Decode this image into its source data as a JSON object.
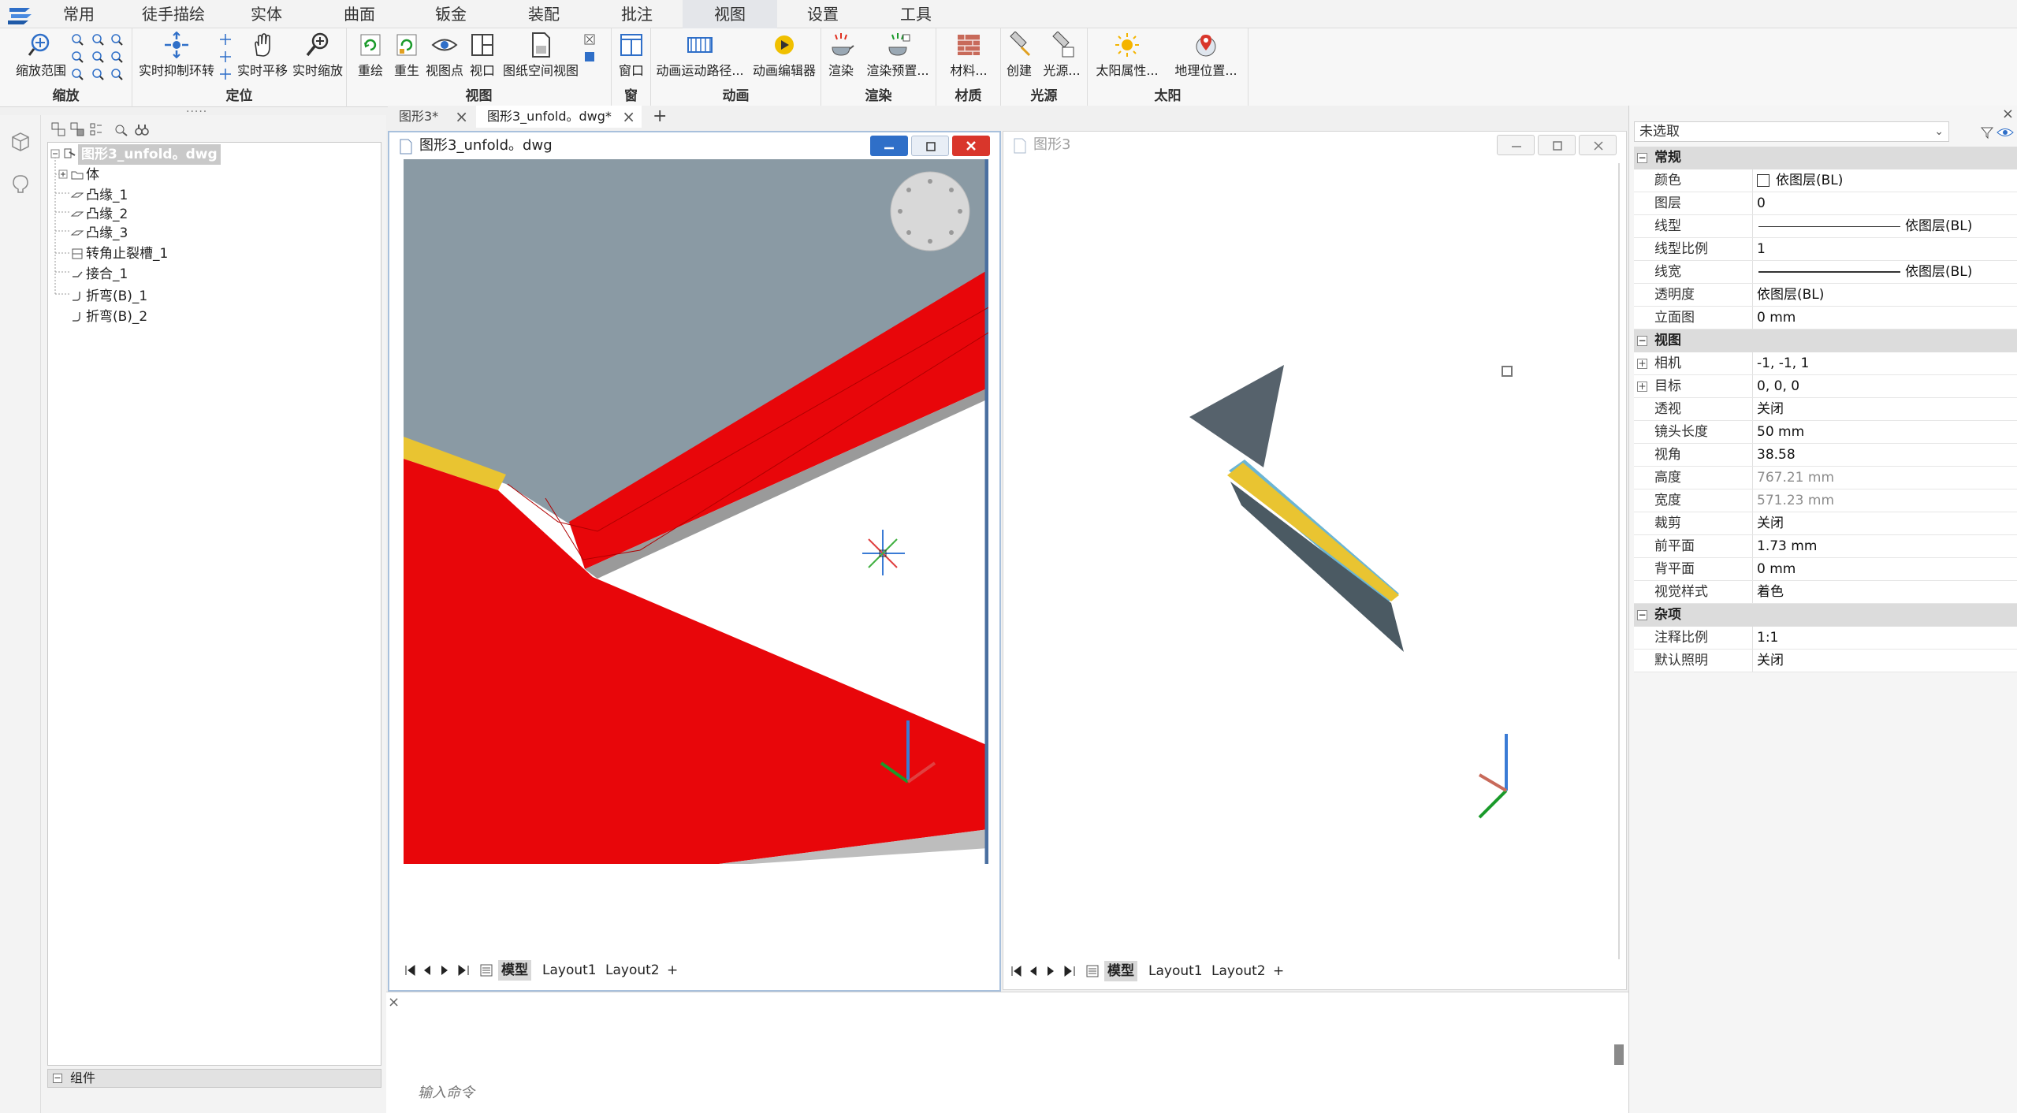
{
  "ribbon": {
    "tabs": [
      {
        "label": "常用"
      },
      {
        "label": "徒手描绘"
      },
      {
        "label": "实体"
      },
      {
        "label": "曲面"
      },
      {
        "label": "钣金"
      },
      {
        "label": "装配"
      },
      {
        "label": "批注"
      },
      {
        "label": "视图"
      },
      {
        "label": "设置"
      },
      {
        "label": "工具"
      }
    ],
    "active_tab": "视图",
    "groups": {
      "zoom": {
        "label": "缩放",
        "buttons": [
          "缩放范围"
        ]
      },
      "position": {
        "label": "定位",
        "buttons": [
          "实时抑制环转",
          "实时平移",
          "实时缩放"
        ]
      },
      "view": {
        "label": "视图",
        "buttons": [
          "重绘",
          "重生",
          "视图点",
          "视口",
          "图纸空间视图"
        ]
      },
      "window": {
        "label": "窗",
        "buttons": [
          "窗口"
        ]
      },
      "animation": {
        "label": "动画",
        "buttons": [
          "动画运动路径...",
          "动画编辑器"
        ]
      },
      "render": {
        "label": "渲染",
        "buttons": [
          "渲染",
          "渲染预置..."
        ]
      },
      "material": {
        "label": "材质",
        "buttons": [
          "材料..."
        ]
      },
      "light": {
        "label": "光源",
        "buttons": [
          "创建",
          "光源..."
        ]
      },
      "sun": {
        "label": "太阳",
        "buttons": [
          "太阳属性...",
          "地理位置..."
        ]
      }
    }
  },
  "browser": {
    "tree": {
      "root": "图形3_unfold。dwg",
      "items": [
        "体",
        "凸缘_1",
        "凸缘_2",
        "凸缘_3",
        "转角止裂槽_1",
        "接合_1",
        "折弯(B)_1",
        "折弯(B)_2"
      ]
    },
    "footer": "组件"
  },
  "doc_tabs": [
    {
      "label": "图形3*"
    },
    {
      "label": "图形3_unfold。dwg*"
    }
  ],
  "windows": {
    "left": {
      "title": "图形3_unfold。dwg"
    },
    "right": {
      "title": "图形3"
    }
  },
  "layout_tabs": {
    "model": "模型",
    "layout1": "Layout1",
    "layout2": "Layout2",
    "add": "+"
  },
  "command": {
    "placeholder": "输入命令"
  },
  "properties": {
    "selection": "未选取",
    "sections": {
      "general": {
        "title": "常规",
        "rows": [
          {
            "key": "颜色",
            "value": "依图层(BL)"
          },
          {
            "key": "图层",
            "value": "0"
          },
          {
            "key": "线型",
            "value": "依图层(BL)"
          },
          {
            "key": "线型比例",
            "value": "1"
          },
          {
            "key": "线宽",
            "value": "依图层(BL)"
          },
          {
            "key": "透明度",
            "value": "依图层(BL)"
          },
          {
            "key": "立面图",
            "value": "0 mm"
          }
        ]
      },
      "view": {
        "title": "视图",
        "rows": [
          {
            "key": "相机",
            "value": "-1, -1, 1"
          },
          {
            "key": "目标",
            "value": "0, 0, 0"
          },
          {
            "key": "透视",
            "value": "关闭"
          },
          {
            "key": "镜头长度",
            "value": "50 mm"
          },
          {
            "key": "视角",
            "value": "38.58"
          },
          {
            "key": "高度",
            "value": "767.21 mm"
          },
          {
            "key": "宽度",
            "value": "571.23 mm"
          },
          {
            "key": "裁剪",
            "value": "关闭"
          },
          {
            "key": "前平面",
            "value": "1.73 mm"
          },
          {
            "key": "背平面",
            "value": "0 mm"
          },
          {
            "key": "视觉样式",
            "value": "着色"
          }
        ]
      },
      "misc": {
        "title": "杂项",
        "rows": [
          {
            "key": "注释比例",
            "value": "1:1"
          },
          {
            "key": "默认照明",
            "value": "关闭"
          }
        ]
      }
    }
  },
  "colors": {
    "accent_blue": "#2f6fc8",
    "close_red": "#d9362b",
    "sheet_red": "#e8060a",
    "sheet_gray": "#8a9aa4",
    "sheet_yellow": "#e9c431"
  }
}
